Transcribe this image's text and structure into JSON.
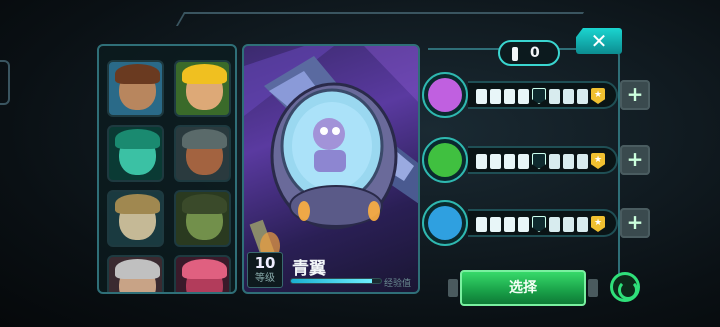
{
  "ship": {
    "level": "10",
    "level_label": "等级",
    "name": "青翼",
    "xp_label": "经验值",
    "xp_fraction": 0.9
  },
  "counter": {
    "value": "0"
  },
  "close": {
    "label": "✕"
  },
  "select_button": {
    "label": "选择"
  },
  "skills": [
    {
      "icon": "claw-slash-icon",
      "color": "#c060e0",
      "pips_filled": 4,
      "plus": "+"
    },
    {
      "icon": "heal-plus-icon",
      "color": "#40c040",
      "pips_filled": 4,
      "plus": "+"
    },
    {
      "icon": "robot-shield-icon",
      "color": "#2fa0e0",
      "pips_filled": 4,
      "plus": "+"
    }
  ],
  "heroes": [
    {
      "name": "hero-soldier",
      "skin": "#c88a5a",
      "hair": "#6a3a20",
      "bg": "#2a6a88"
    },
    {
      "name": "hero-blonde",
      "skin": "#f0b080",
      "hair": "#f0c020",
      "bg": "#3a6a2a"
    },
    {
      "name": "hero-ghost",
      "skin": "#40d0b0",
      "hair": "#1a8a70",
      "bg": "#0a3a34"
    },
    {
      "name": "hero-robot",
      "skin": "#b06840",
      "hair": "#5a6a6a",
      "bg": "#2a3a3e"
    },
    {
      "name": "hero-egg",
      "skin": "#d8c8a0",
      "hair": "#a08850",
      "bg": "#1a3a40"
    },
    {
      "name": "hero-beast",
      "skin": "#7a9a50",
      "hair": "#3a4a2a",
      "bg": "#2a3a20"
    },
    {
      "name": "hero-elder",
      "skin": "#d8b090",
      "hair": "#c0c0c0",
      "bg": "#3a2a30"
    },
    {
      "name": "hero-red",
      "skin": "#c04060",
      "hair": "#e06080",
      "bg": "#3a1a2a"
    }
  ]
}
